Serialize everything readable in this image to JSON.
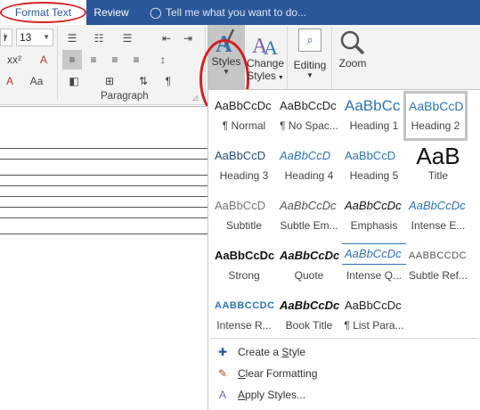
{
  "tabs": {
    "format_text": "Format Text",
    "review": "Review",
    "tell_me": "Tell me what you want to do..."
  },
  "ribbon": {
    "font_name_fragment": "i",
    "font_size": "13",
    "paragraph_label": "Paragraph",
    "styles_label": "Styles",
    "change_styles_line1": "Change",
    "change_styles_line2": "Styles",
    "editing_label": "Editing",
    "zoom_label": "Zoom",
    "superscript": "x²",
    "change_case": "Aa",
    "pilcrow": "¶"
  },
  "gallery": {
    "styles": [
      {
        "sample": "AaBbCcDc",
        "name": "¶ Normal"
      },
      {
        "sample": "AaBbCcDc",
        "name": "¶ No Spac..."
      },
      {
        "sample": "AaBbCc",
        "name": "Heading 1"
      },
      {
        "sample": "AaBbCcD",
        "name": "Heading 2"
      },
      {
        "sample": "AaBbCcD",
        "name": "Heading 3"
      },
      {
        "sample": "AaBbCcD",
        "name": "Heading 4"
      },
      {
        "sample": "AaBbCcD",
        "name": "Heading 5"
      },
      {
        "sample": "AaB",
        "name": "Title"
      },
      {
        "sample": "AaBbCcD",
        "name": "Subtitle"
      },
      {
        "sample": "AaBbCcDc",
        "name": "Subtle Em..."
      },
      {
        "sample": "AaBbCcDc",
        "name": "Emphasis"
      },
      {
        "sample": "AaBbCcDc",
        "name": "Intense E..."
      },
      {
        "sample": "AaBbCcDc",
        "name": "Strong"
      },
      {
        "sample": "AaBbCcDc",
        "name": "Quote"
      },
      {
        "sample": "AaBbCcDc",
        "name": "Intense Q..."
      },
      {
        "sample": "AaBbCcDc",
        "name": "Subtle Ref..."
      },
      {
        "sample": "AaBbCcDc",
        "name": "Intense R..."
      },
      {
        "sample": "AaBbCcDc",
        "name": "Book Title"
      },
      {
        "sample": "AaBbCcDc",
        "name": "¶ List Para..."
      }
    ],
    "menu": {
      "create_prefix": "Create a ",
      "create_underlined": "S",
      "create_suffix": "tyle",
      "clear_underlined": "C",
      "clear_suffix": "lear Formatting",
      "apply_underlined": "A",
      "apply_suffix": "pply Styles..."
    }
  },
  "colors": {
    "accent": "#2b579a",
    "highlight_circle": "#d42020",
    "heading_blue": "#2e74b5"
  }
}
